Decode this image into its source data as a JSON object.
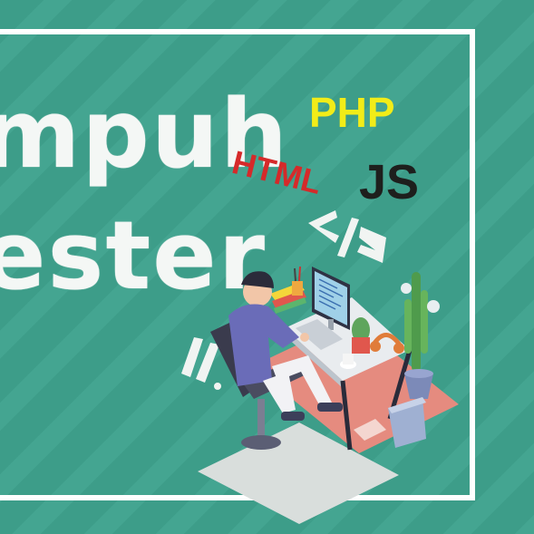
{
  "banner": {
    "line1": "mpuh",
    "line2": "ester"
  },
  "languages": {
    "php": "PHP",
    "html": "HTML",
    "js": "JS"
  },
  "icons": [
    "code-tag-icon",
    "slash-marks-icon"
  ],
  "colors": {
    "background": "#3d9d89",
    "php": "#f2ec18",
    "html": "#d52a2a",
    "js": "#1e1f1d",
    "frame": "#ffffff"
  }
}
